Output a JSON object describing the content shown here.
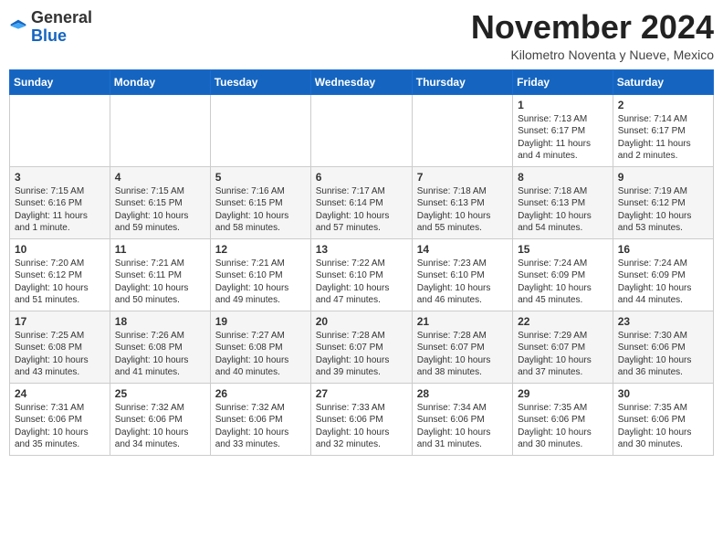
{
  "header": {
    "logo_general": "General",
    "logo_blue": "Blue",
    "month_title": "November 2024",
    "location": "Kilometro Noventa y Nueve, Mexico"
  },
  "weekdays": [
    "Sunday",
    "Monday",
    "Tuesday",
    "Wednesday",
    "Thursday",
    "Friday",
    "Saturday"
  ],
  "weeks": [
    [
      {
        "day": "",
        "info": ""
      },
      {
        "day": "",
        "info": ""
      },
      {
        "day": "",
        "info": ""
      },
      {
        "day": "",
        "info": ""
      },
      {
        "day": "",
        "info": ""
      },
      {
        "day": "1",
        "info": "Sunrise: 7:13 AM\nSunset: 6:17 PM\nDaylight: 11 hours\nand 4 minutes."
      },
      {
        "day": "2",
        "info": "Sunrise: 7:14 AM\nSunset: 6:17 PM\nDaylight: 11 hours\nand 2 minutes."
      }
    ],
    [
      {
        "day": "3",
        "info": "Sunrise: 7:15 AM\nSunset: 6:16 PM\nDaylight: 11 hours\nand 1 minute."
      },
      {
        "day": "4",
        "info": "Sunrise: 7:15 AM\nSunset: 6:15 PM\nDaylight: 10 hours\nand 59 minutes."
      },
      {
        "day": "5",
        "info": "Sunrise: 7:16 AM\nSunset: 6:15 PM\nDaylight: 10 hours\nand 58 minutes."
      },
      {
        "day": "6",
        "info": "Sunrise: 7:17 AM\nSunset: 6:14 PM\nDaylight: 10 hours\nand 57 minutes."
      },
      {
        "day": "7",
        "info": "Sunrise: 7:18 AM\nSunset: 6:13 PM\nDaylight: 10 hours\nand 55 minutes."
      },
      {
        "day": "8",
        "info": "Sunrise: 7:18 AM\nSunset: 6:13 PM\nDaylight: 10 hours\nand 54 minutes."
      },
      {
        "day": "9",
        "info": "Sunrise: 7:19 AM\nSunset: 6:12 PM\nDaylight: 10 hours\nand 53 minutes."
      }
    ],
    [
      {
        "day": "10",
        "info": "Sunrise: 7:20 AM\nSunset: 6:12 PM\nDaylight: 10 hours\nand 51 minutes."
      },
      {
        "day": "11",
        "info": "Sunrise: 7:21 AM\nSunset: 6:11 PM\nDaylight: 10 hours\nand 50 minutes."
      },
      {
        "day": "12",
        "info": "Sunrise: 7:21 AM\nSunset: 6:10 PM\nDaylight: 10 hours\nand 49 minutes."
      },
      {
        "day": "13",
        "info": "Sunrise: 7:22 AM\nSunset: 6:10 PM\nDaylight: 10 hours\nand 47 minutes."
      },
      {
        "day": "14",
        "info": "Sunrise: 7:23 AM\nSunset: 6:10 PM\nDaylight: 10 hours\nand 46 minutes."
      },
      {
        "day": "15",
        "info": "Sunrise: 7:24 AM\nSunset: 6:09 PM\nDaylight: 10 hours\nand 45 minutes."
      },
      {
        "day": "16",
        "info": "Sunrise: 7:24 AM\nSunset: 6:09 PM\nDaylight: 10 hours\nand 44 minutes."
      }
    ],
    [
      {
        "day": "17",
        "info": "Sunrise: 7:25 AM\nSunset: 6:08 PM\nDaylight: 10 hours\nand 43 minutes."
      },
      {
        "day": "18",
        "info": "Sunrise: 7:26 AM\nSunset: 6:08 PM\nDaylight: 10 hours\nand 41 minutes."
      },
      {
        "day": "19",
        "info": "Sunrise: 7:27 AM\nSunset: 6:08 PM\nDaylight: 10 hours\nand 40 minutes."
      },
      {
        "day": "20",
        "info": "Sunrise: 7:28 AM\nSunset: 6:07 PM\nDaylight: 10 hours\nand 39 minutes."
      },
      {
        "day": "21",
        "info": "Sunrise: 7:28 AM\nSunset: 6:07 PM\nDaylight: 10 hours\nand 38 minutes."
      },
      {
        "day": "22",
        "info": "Sunrise: 7:29 AM\nSunset: 6:07 PM\nDaylight: 10 hours\nand 37 minutes."
      },
      {
        "day": "23",
        "info": "Sunrise: 7:30 AM\nSunset: 6:06 PM\nDaylight: 10 hours\nand 36 minutes."
      }
    ],
    [
      {
        "day": "24",
        "info": "Sunrise: 7:31 AM\nSunset: 6:06 PM\nDaylight: 10 hours\nand 35 minutes."
      },
      {
        "day": "25",
        "info": "Sunrise: 7:32 AM\nSunset: 6:06 PM\nDaylight: 10 hours\nand 34 minutes."
      },
      {
        "day": "26",
        "info": "Sunrise: 7:32 AM\nSunset: 6:06 PM\nDaylight: 10 hours\nand 33 minutes."
      },
      {
        "day": "27",
        "info": "Sunrise: 7:33 AM\nSunset: 6:06 PM\nDaylight: 10 hours\nand 32 minutes."
      },
      {
        "day": "28",
        "info": "Sunrise: 7:34 AM\nSunset: 6:06 PM\nDaylight: 10 hours\nand 31 minutes."
      },
      {
        "day": "29",
        "info": "Sunrise: 7:35 AM\nSunset: 6:06 PM\nDaylight: 10 hours\nand 30 minutes."
      },
      {
        "day": "30",
        "info": "Sunrise: 7:35 AM\nSunset: 6:06 PM\nDaylight: 10 hours\nand 30 minutes."
      }
    ]
  ]
}
